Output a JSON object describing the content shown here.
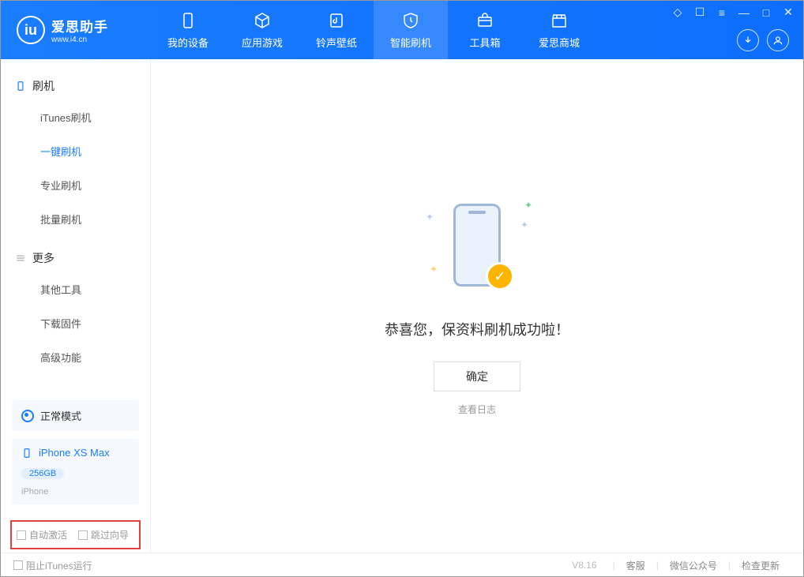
{
  "logo": {
    "title": "爱思助手",
    "sub": "www.i4.cn"
  },
  "tabs": {
    "device": "我的设备",
    "apps": "应用游戏",
    "ring": "铃声壁纸",
    "flash": "智能刷机",
    "tools": "工具箱",
    "store": "爱思商城"
  },
  "sidebar": {
    "section1": "刷机",
    "items1": {
      "itunes": "iTunes刷机",
      "oneclick": "一键刷机",
      "pro": "专业刷机",
      "batch": "批量刷机"
    },
    "section2": "更多",
    "items2": {
      "other": "其他工具",
      "firmware": "下载固件",
      "advanced": "高级功能"
    }
  },
  "device": {
    "mode": "正常模式",
    "name": "iPhone XS Max",
    "capacity": "256GB",
    "type": "iPhone"
  },
  "checks": {
    "auto": "自动激活",
    "skip": "跳过向导"
  },
  "main": {
    "success": "恭喜您，保资料刷机成功啦！",
    "ok": "确定",
    "log": "查看日志"
  },
  "footer": {
    "block_itunes": "阻止iTunes运行",
    "version": "V8.16",
    "links": {
      "service": "客服",
      "wechat": "微信公众号",
      "update": "检查更新"
    }
  }
}
